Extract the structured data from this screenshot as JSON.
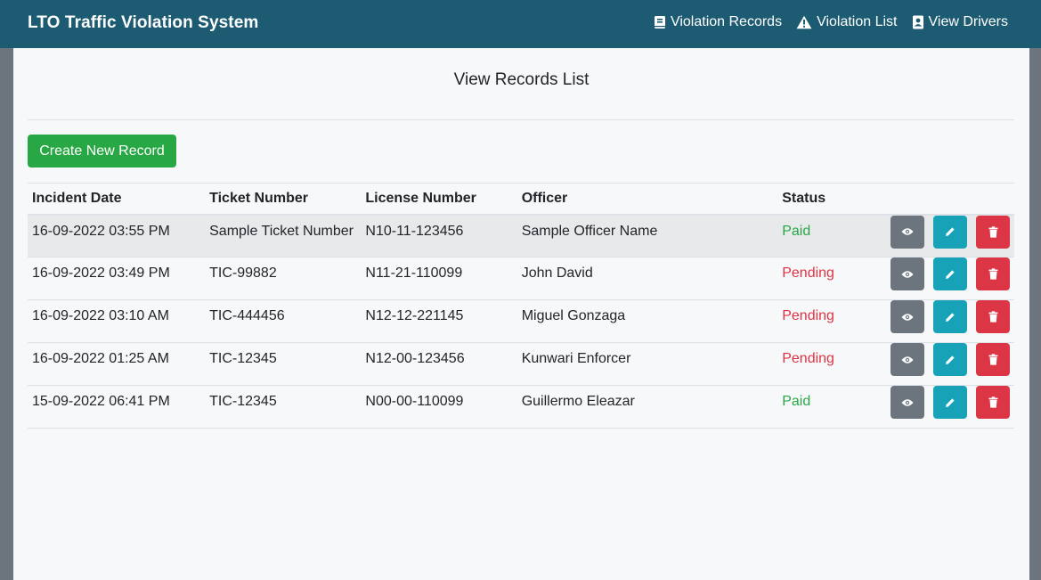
{
  "navbar": {
    "brand": "LTO Traffic Violation System",
    "links": [
      {
        "label": "Violation Records",
        "icon": "book-icon"
      },
      {
        "label": "Violation List",
        "icon": "warning-icon"
      },
      {
        "label": "View Drivers",
        "icon": "address-card-icon"
      }
    ]
  },
  "page": {
    "title": "View Records List",
    "create_button": "Create New Record"
  },
  "table": {
    "headers": [
      "Incident Date",
      "Ticket Number",
      "License Number",
      "Officer",
      "Status"
    ],
    "rows": [
      {
        "date": "16-09-2022 03:55 PM",
        "ticket": "Sample Ticket Number",
        "license": "N10-11-123456",
        "officer": "Sample Officer Name",
        "status": "Paid"
      },
      {
        "date": "16-09-2022 03:49 PM",
        "ticket": "TIC-99882",
        "license": "N11-21-110099",
        "officer": "John David",
        "status": "Pending"
      },
      {
        "date": "16-09-2022 03:10 AM",
        "ticket": "TIC-444456",
        "license": "N12-12-221145",
        "officer": "Miguel Gonzaga",
        "status": "Pending"
      },
      {
        "date": "16-09-2022 01:25 AM",
        "ticket": "TIC-12345",
        "license": "N12-00-123456",
        "officer": "Kunwari Enforcer",
        "status": "Pending"
      },
      {
        "date": "15-09-2022 06:41 PM",
        "ticket": "TIC-12345",
        "license": "N00-00-110099",
        "officer": "Guillermo Eleazar",
        "status": "Paid"
      }
    ],
    "row_actions": [
      "eye-icon",
      "pencil-icon",
      "trash-icon"
    ]
  },
  "colors": {
    "navbar": "#1d5b72",
    "success": "#28a745",
    "danger": "#dc3545",
    "info": "#17a2b8",
    "secondary": "#6c757d"
  }
}
